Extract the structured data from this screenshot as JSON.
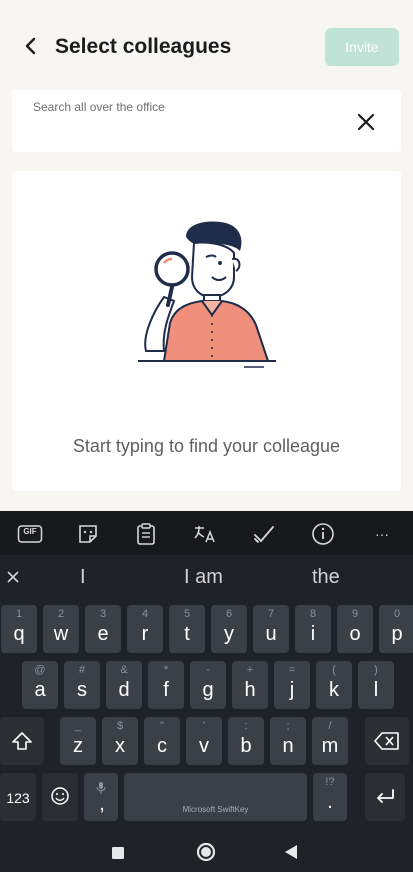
{
  "header": {
    "title": "Select colleagues",
    "invite_label": "Invite"
  },
  "search": {
    "label": "Search all over the office",
    "value": ""
  },
  "empty_state": {
    "message": "Start typing to find your colleague"
  },
  "keyboard": {
    "toolbar": [
      "gif-icon",
      "sticker-icon",
      "clipboard-icon",
      "translate-icon",
      "check-icon",
      "info-icon",
      "more-icon"
    ],
    "gif_label": "GIF",
    "more_label": "···",
    "suggestions": [
      "I",
      "I am",
      "the"
    ],
    "row1": [
      {
        "k": "q",
        "h": "1"
      },
      {
        "k": "w",
        "h": "2"
      },
      {
        "k": "e",
        "h": "3"
      },
      {
        "k": "r",
        "h": "4"
      },
      {
        "k": "t",
        "h": "5"
      },
      {
        "k": "y",
        "h": "6"
      },
      {
        "k": "u",
        "h": "7"
      },
      {
        "k": "i",
        "h": "8"
      },
      {
        "k": "o",
        "h": "9"
      },
      {
        "k": "p",
        "h": "0"
      }
    ],
    "row2": [
      {
        "k": "a",
        "h": "@"
      },
      {
        "k": "s",
        "h": "#"
      },
      {
        "k": "d",
        "h": "&"
      },
      {
        "k": "f",
        "h": "*"
      },
      {
        "k": "g",
        "h": "-"
      },
      {
        "k": "h",
        "h": "+"
      },
      {
        "k": "j",
        "h": "="
      },
      {
        "k": "k",
        "h": "("
      },
      {
        "k": "l",
        "h": ")"
      }
    ],
    "row3": [
      {
        "k": "z",
        "h": "_"
      },
      {
        "k": "x",
        "h": "$"
      },
      {
        "k": "c",
        "h": "\""
      },
      {
        "k": "v",
        "h": "'"
      },
      {
        "k": "b",
        "h": ":"
      },
      {
        "k": "n",
        "h": ";"
      },
      {
        "k": "m",
        "h": "/"
      }
    ],
    "key_123": "123",
    "comma": ",",
    "period": ".",
    "period_hint": "!?",
    "space_label": "Microsoft SwiftKey"
  },
  "colors": {
    "accent": "#bfe3d6",
    "illustration_shirt": "#f0907c",
    "keyboard_bg": "#1f2227",
    "key_bg": "#3b3f46"
  }
}
